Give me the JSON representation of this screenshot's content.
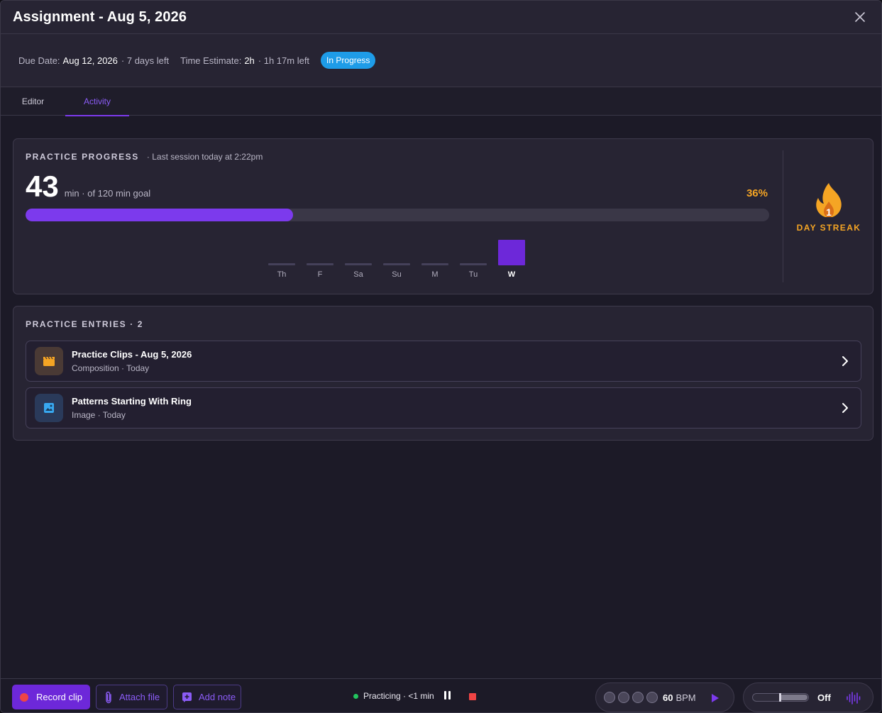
{
  "window": {
    "title": "Assignment - Aug 5, 2026"
  },
  "meta": {
    "due_label": "Due Date:",
    "due_value": "Aug 12, 2026",
    "due_remaining": "· 7 days left",
    "estimate_label": "Time Estimate:",
    "estimate_value": "2h",
    "estimate_remaining": "· 1h 17m left",
    "status": "In Progress"
  },
  "tabs": [
    {
      "label": "Editor",
      "active": false
    },
    {
      "label": "Activity",
      "active": true
    }
  ],
  "progress": {
    "title": "PRACTICE PROGRESS",
    "last_session": "· Last session today at 2:22pm",
    "minutes": "43",
    "goal_text": "min · of 120 min goal",
    "percent_label": "36%",
    "percent_value": 0.36,
    "week": [
      {
        "label": "Th",
        "minutes": 0,
        "active": false
      },
      {
        "label": "F",
        "minutes": 0,
        "active": false
      },
      {
        "label": "Sa",
        "minutes": 0,
        "active": false
      },
      {
        "label": "Su",
        "minutes": 0,
        "active": false
      },
      {
        "label": "M",
        "minutes": 0,
        "active": false
      },
      {
        "label": "Tu",
        "minutes": 0,
        "active": false
      },
      {
        "label": "W",
        "minutes": 43,
        "active": true
      }
    ],
    "streak_count": "1",
    "streak_label": "DAY STREAK"
  },
  "entries": {
    "title": "PRACTICE ENTRIES · 2",
    "items": [
      {
        "title": "Practice Clips - Aug 5, 2026",
        "subtitle": "Composition · Today",
        "icon": "clapperboard-icon"
      },
      {
        "title": "Patterns Starting With Ring",
        "subtitle": "Image · Today",
        "icon": "image-icon"
      }
    ]
  },
  "toolbar": {
    "record_label": "Record clip",
    "attach_label": "Attach file",
    "note_label": "Add note",
    "practicing_text": "Practicing · <1 min",
    "bpm_value": "60",
    "bpm_unit": "BPM",
    "drone_state": "Off"
  },
  "colors": {
    "accent": "#7c3aed",
    "status_blue": "#1e9ce8",
    "streak_orange": "#f5a524",
    "record_red": "#ef4444"
  }
}
